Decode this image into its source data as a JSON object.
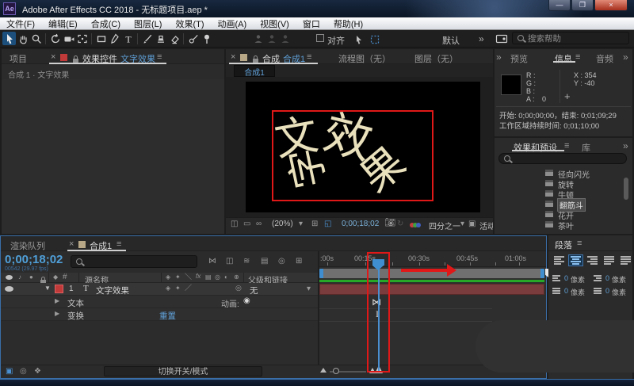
{
  "window": {
    "app_initials": "Ae",
    "title": "Adobe After Effects CC 2018 - 无标题项目.aep *",
    "buttons": {
      "minimize": "—",
      "maximize": "❐",
      "close": "×"
    }
  },
  "menu": {
    "items": [
      "文件(F)",
      "编辑(E)",
      "合成(C)",
      "图层(L)",
      "效果(T)",
      "动画(A)",
      "视图(V)",
      "窗口",
      "帮助(H)"
    ]
  },
  "toolbar": {
    "align": "对齐",
    "workspace": "默认",
    "more": "»",
    "search_placeholder": "搜索帮助"
  },
  "project_panel": {
    "tab_project": "项目",
    "close": "×",
    "tab_label": "效果控件",
    "tab_target": "文字效果",
    "menu": "≡",
    "breadcrumb": "合成 1 · 文字效果"
  },
  "comp_panel": {
    "close": "×",
    "tab_prefix": "合成",
    "tab_name": "合成1",
    "menu": "≡",
    "tab_flowchart": "流程图（无）",
    "tab_layer": "图层（无）",
    "viewer_tab": "合成1",
    "zoom_level": "(20%)",
    "caret": "▾",
    "timecode": "0;00;18;02",
    "resolution": "四分之一",
    "camera_label": "活动",
    "chars": [
      "文",
      "字",
      "效",
      "果"
    ]
  },
  "info_panel": {
    "more": "»",
    "tab_preview": "预览",
    "tab_info": "信息",
    "menu": "≡",
    "tab_audio": "音频",
    "r_label": "R :",
    "g_label": "G :",
    "b_label": "B :",
    "a_label": "A :",
    "a_value": "0",
    "x_value": "X : 354",
    "y_value": "Y : -40",
    "crosshair": "+",
    "range_line": "开始: 0;00;00;00，结束: 0;01;09;29",
    "duration_line": "工作区域持续时间: 0;01;10;00"
  },
  "effects_panel": {
    "tab_effects": "效果和预设",
    "menu": "≡",
    "tab_library": "库",
    "more": "»",
    "presets": [
      {
        "label": "径向闪光"
      },
      {
        "label": "旋转"
      },
      {
        "label": "牛顿"
      },
      {
        "label": "翻筋斗"
      },
      {
        "label": "花开"
      },
      {
        "label": "茶叶"
      }
    ]
  },
  "timeline": {
    "tab_render_queue": "渲染队列",
    "close": "×",
    "tab_comp": "合成1",
    "menu": "≡",
    "timecode": "0;00;18;02",
    "frames": "00542 (29.97 fps)",
    "hash": "#",
    "col_source": "源名称",
    "fx_label": "fx",
    "col_parent": "父级和链接",
    "expand": "▼",
    "collapse": "▶",
    "layer_num": "1",
    "layer_type": "T",
    "layer_name": "文字效果",
    "parent_value": "无",
    "caret": "▾",
    "prop_text": "文本",
    "animate_label": "动画:",
    "prop_transform": "变换",
    "reset_label": "重置",
    "ruler": [
      ":00s",
      "00:15s",
      "00:30s",
      "00:45s",
      "01:00s"
    ],
    "toggle_label": "切换开关/模式"
  },
  "paragraph": {
    "title": "段落",
    "menu": "≡",
    "value": "0",
    "unit": "像素"
  },
  "colors": {
    "accent_blue": "#4f9fd8",
    "annotation_red": "#e01818",
    "label_red": "#c03a3a",
    "work_green": "#27a827",
    "bar_maroon": "#7a3c3c",
    "text_cream": "#e9e0bc"
  }
}
